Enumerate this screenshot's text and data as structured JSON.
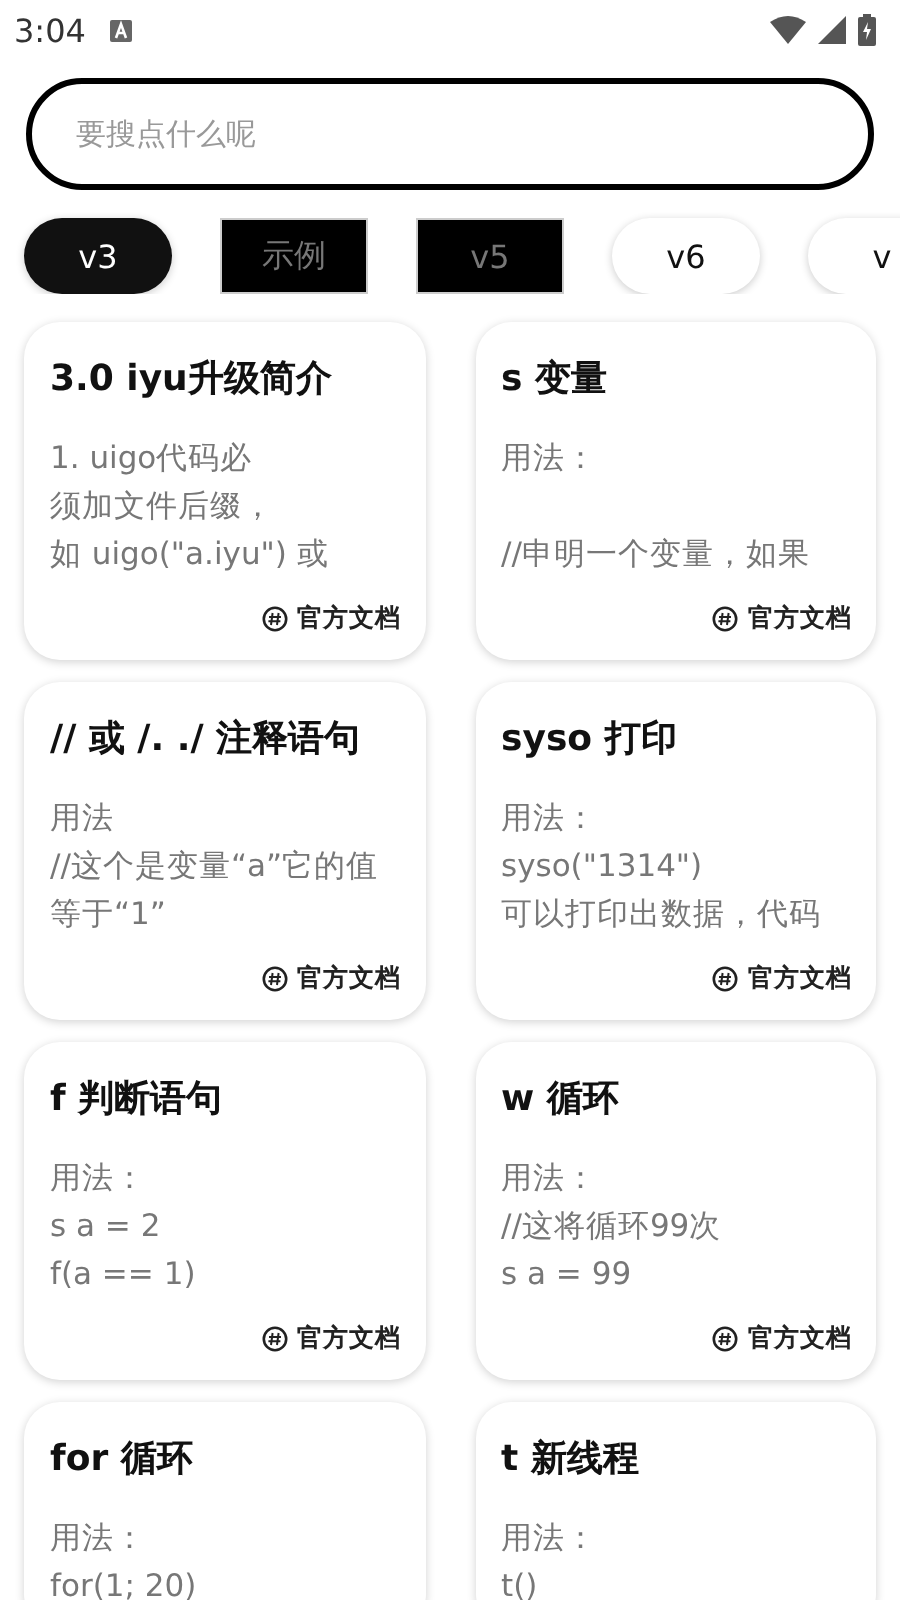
{
  "status_bar": {
    "time": "3:04"
  },
  "search": {
    "placeholder": "要搜点什么呢"
  },
  "tabs": [
    {
      "label": "v3",
      "selected": true,
      "kind": "pill"
    },
    {
      "label": "示例",
      "selected": false,
      "kind": "blackout"
    },
    {
      "label": "v5",
      "selected": false,
      "kind": "blackout"
    },
    {
      "label": "v6",
      "selected": false,
      "kind": "pill"
    },
    {
      "label": "v",
      "selected": false,
      "kind": "pill"
    }
  ],
  "columns": [
    [
      {
        "title": "3.0 iyu升级简介",
        "body": [
          "1. uigo代码必",
          "须加文件后缀，",
          "如 uigo(\"a.iyu\") 或"
        ],
        "link": "官方文档"
      },
      {
        "title": "// 或 /. ./ 注释语句",
        "body": [
          "用法",
          "//这个是变量“a”它的值",
          "等于“1”"
        ],
        "link": "官方文档"
      },
      {
        "title": "f 判断语句",
        "body": [
          "用法：",
          "s a = 2",
          "f(a == 1)"
        ],
        "link": "官方文档"
      },
      {
        "title": "for 循环",
        "body": [
          "用法：",
          "for(1; 20)"
        ]
      }
    ],
    [
      {
        "title": "s 变量",
        "body": [
          "用法：\n\n//申明一个变量，如果"
        ],
        "link": "官方文档"
      },
      {
        "title": "syso 打印",
        "body": [
          "用法：",
          "syso(\"1314\")",
          "可以打印出数据，代码"
        ],
        "link": "官方文档"
      },
      {
        "title": "w 循环",
        "body": [
          "用法：",
          "//这将循环99次",
          "s a = 99"
        ],
        "link": "官方文档"
      },
      {
        "title": "t 新线程",
        "body": [
          "用法：",
          "t()"
        ]
      }
    ]
  ]
}
